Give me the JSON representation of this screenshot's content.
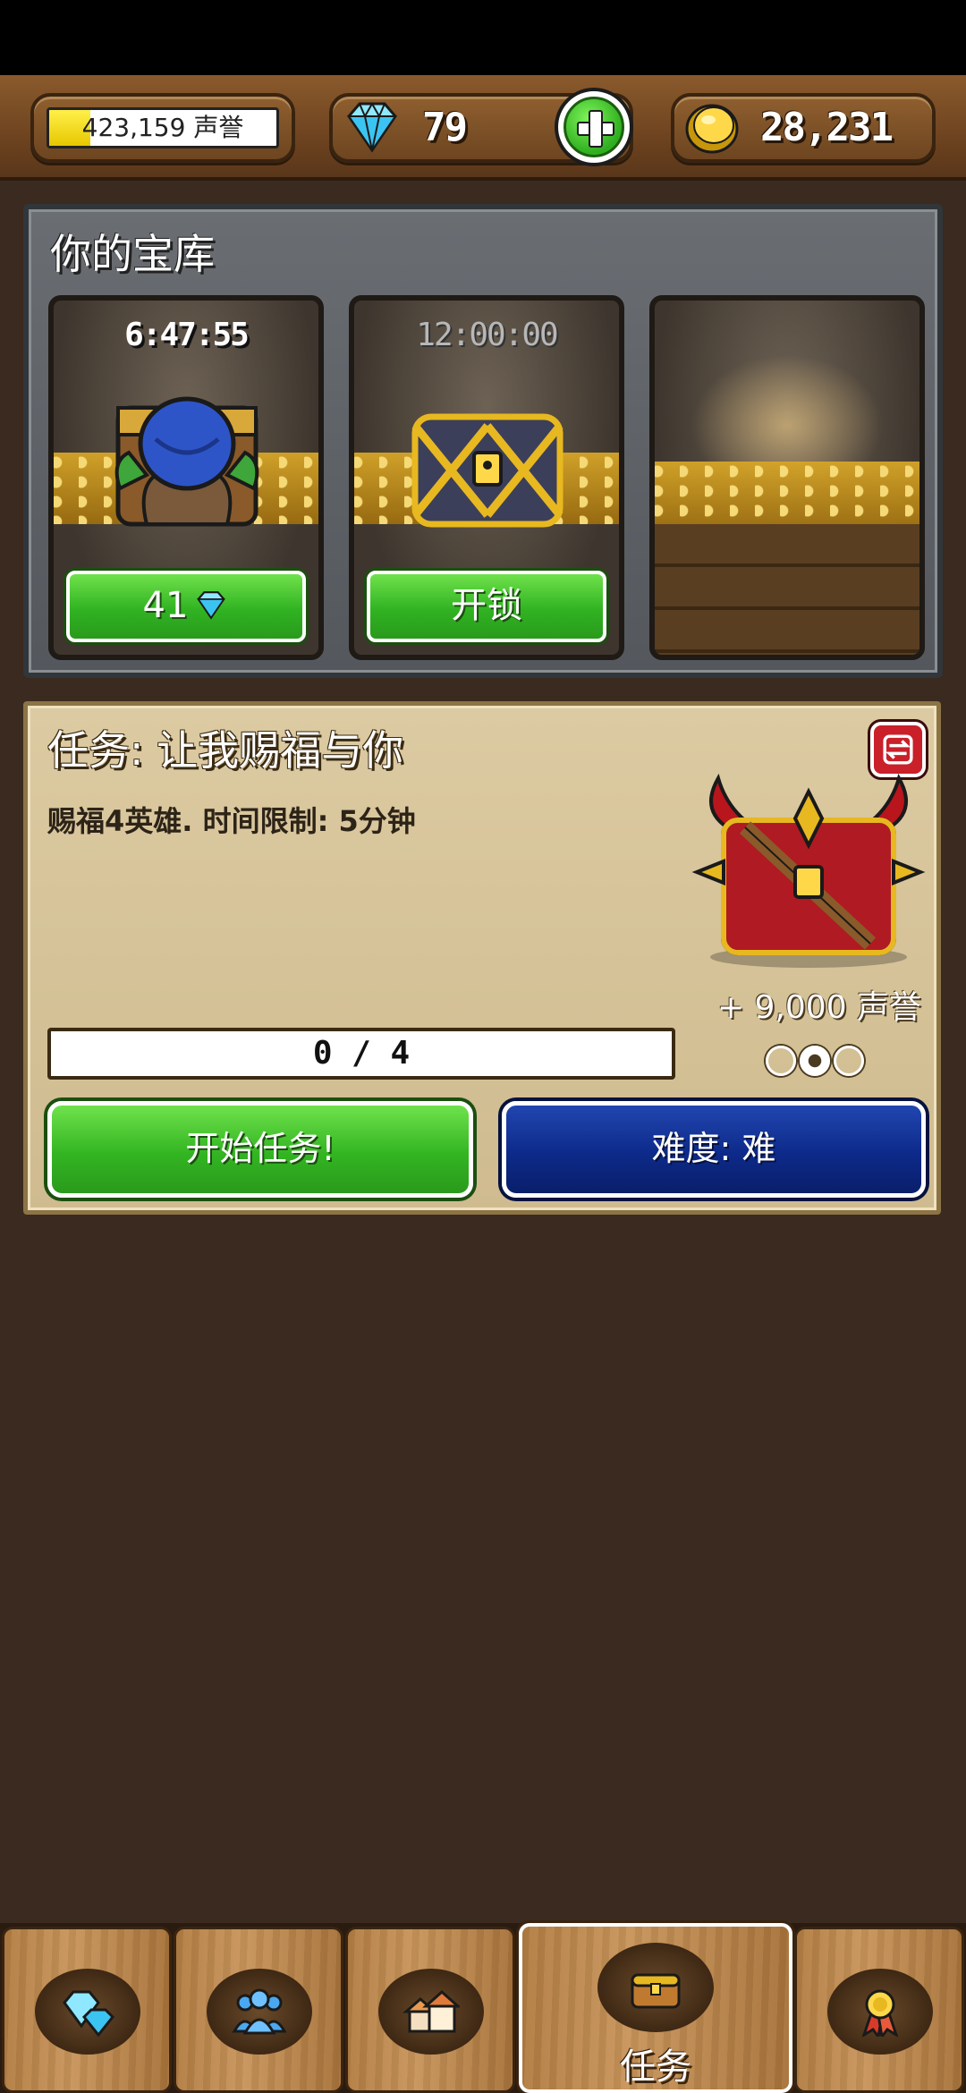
{
  "top_bar": {
    "reputation": {
      "value_text": "423,159 声誉",
      "fill_fraction": 0.18
    },
    "gems": {
      "value": "79",
      "icon": "diamond-icon"
    },
    "coins": {
      "value": "28,231",
      "icon": "gold-coin-icon"
    },
    "add_button_icon": "plus-icon"
  },
  "vault": {
    "title": "你的宝库",
    "slots": [
      {
        "timer": "6:47:55",
        "button_label": "41",
        "button_icon": "diamond-icon",
        "content": "opened-chest-with-goblin"
      },
      {
        "timer": "12:00:00",
        "button_label": "开锁",
        "content": "locked-gold-chest"
      },
      {
        "timer": "",
        "content": "empty-slot"
      }
    ]
  },
  "quest": {
    "title": "任务: 让我赐福与你",
    "description": "赐福4英雄. 时间限制: 5分钟",
    "reward": "+ 9,000 声誉",
    "progress_text": "0 / 4",
    "progress_fraction": 0,
    "difficulty_level": 2,
    "difficulty_max": 3,
    "start_button": "开始任务!",
    "difficulty_button": "难度: 难",
    "swap_icon": "swap-icon",
    "reward_icon": "red-horned-chest-icon"
  },
  "bottom_nav": {
    "tabs": [
      {
        "name": "gems",
        "icon": "gems-icon",
        "label": ""
      },
      {
        "name": "heroes",
        "icon": "heroes-icon",
        "label": ""
      },
      {
        "name": "buildings",
        "icon": "buildings-icon",
        "label": ""
      },
      {
        "name": "quests",
        "icon": "chest-icon",
        "label": "任务",
        "active": true
      },
      {
        "name": "rewards",
        "icon": "medal-icon",
        "label": ""
      }
    ]
  },
  "colors": {
    "background": "#3b2a1f",
    "green_button": "#33b522",
    "blue_button": "#0d2a8a",
    "gold": "#e7c700"
  }
}
